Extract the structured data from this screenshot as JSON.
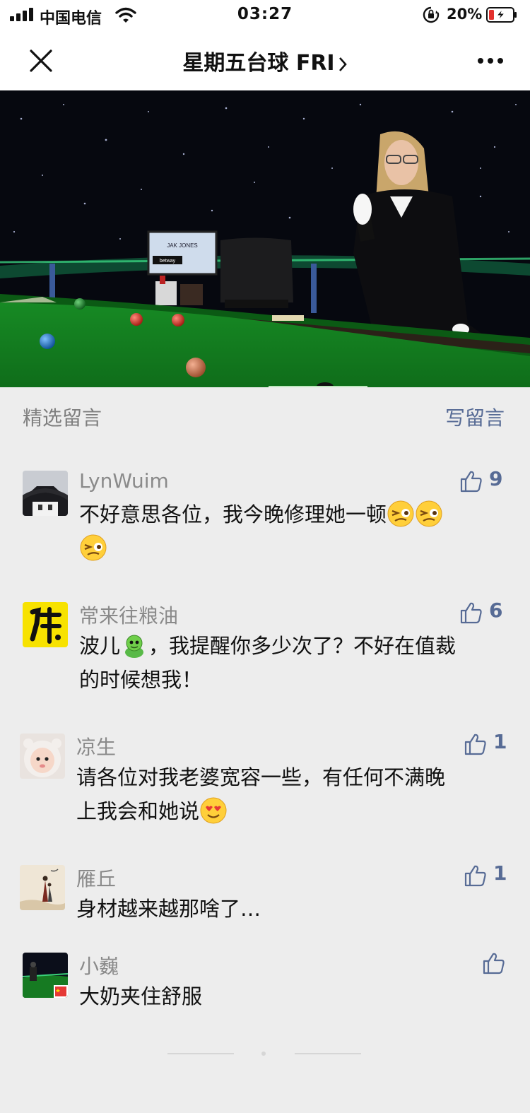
{
  "status_bar": {
    "carrier": "中国电信",
    "time": "03:27",
    "battery_percent": "20%",
    "battery_level": 0.2,
    "icons": [
      "signal-icon",
      "wifi-icon",
      "orientation-lock-icon",
      "battery-charging-icon"
    ]
  },
  "nav": {
    "title": "星期五台球 FRI",
    "close_icon": "close-icon",
    "more_icon": "more-icon",
    "chevron_icon": "chevron-right-icon"
  },
  "video": {
    "monitor_name": "JAK JONES",
    "monitor_brand": "betway"
  },
  "comments_section": {
    "title": "精选留言",
    "write_label": "写留言"
  },
  "comments": [
    {
      "name": "LynWuim",
      "likes": "9",
      "line1": "不好意思各位，我今晚修理她一顿",
      "line2": ""
    },
    {
      "name": "常来往粮油",
      "likes": "6",
      "line1_a": "波儿",
      "line1_b": "，我提醒你多少次了？不好在值裁",
      "line2": "的时候想我！"
    },
    {
      "name": "凉生",
      "likes": "1",
      "line1": "请各位对我老婆宽容一些，有任何不满晚",
      "line2": "上我会和她说"
    },
    {
      "name": "雁丘",
      "likes": "1",
      "line1": "身材越来越那啥了…",
      "line2": ""
    },
    {
      "name": "小巍",
      "likes": "",
      "line1": "大奶夹住舒服",
      "line2": ""
    }
  ],
  "colors": {
    "link_blue": "#576b95",
    "background": "#ededed",
    "name_gray": "#8a8a8a",
    "table_green": "#1f8a2a"
  }
}
